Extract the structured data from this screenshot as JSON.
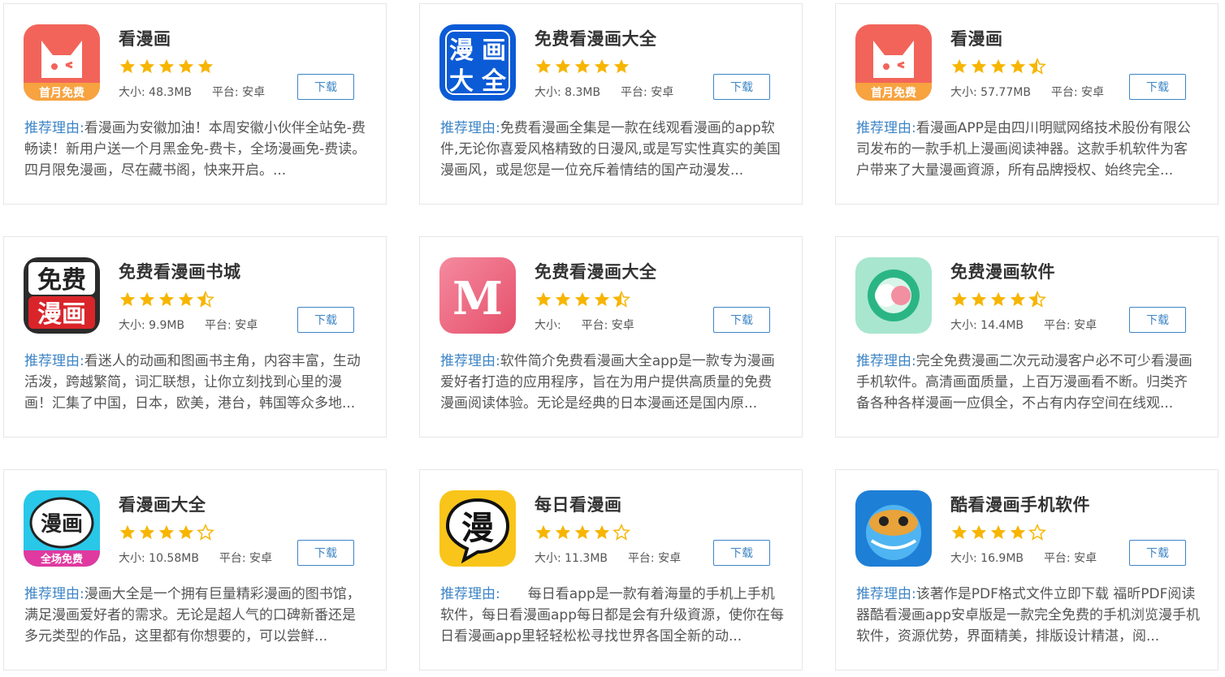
{
  "colors": {
    "accent": "#3d85c6",
    "star": "#f7b500",
    "star_empty": "#f7b500"
  },
  "download_label": "下载",
  "size_label": "大小:",
  "platform_label": "平台:",
  "reason_label": "推荐理由:",
  "apps": [
    {
      "title": "看漫画",
      "icon": "red-cat-free-month-icon",
      "rating": 5,
      "size": "48.3MB",
      "platform": "安卓",
      "reason": "看漫画为安徽加油！本周安徽小伙伴全站免-费畅读！新用户送一个月黑金免-费卡，全场漫画免-费读。四月限免漫画，尽在藏书阁，快来开启。..."
    },
    {
      "title": "免费看漫画大全",
      "icon": "blue-manhua-daquan-icon",
      "rating": 5,
      "size": "8.3MB",
      "platform": "安卓",
      "reason": "免费看漫画全集是一款在线观看漫画的app软件,无论你喜爱风格精致的日漫风,或是写实性真实的美国漫画风，或是您是一位充斥着情结的国产动漫发..."
    },
    {
      "title": "看漫画",
      "icon": "red-cat-free-month-icon",
      "rating": 4.5,
      "size": "57.77MB",
      "platform": "安卓",
      "reason": "看漫画APP是由四川明赋网络技术股份有限公司发布的一款手机上漫画阅读神器。这款手机软件为客户带来了大量漫画資源，所有品牌授权、始终完全..."
    },
    {
      "title": "免费看漫画书城",
      "icon": "free-manhua-black-red-icon",
      "rating": 4.5,
      "size": "9.9MB",
      "platform": "安卓",
      "reason": "看迷人的动画和图画书主角，内容丰富，生动活泼，跨越繁简，词汇联想，让你立刻找到心里的漫画！汇集了中国，日本，欧美，港台，韩国等众多地..."
    },
    {
      "title": "免费看漫画大全",
      "icon": "pink-m-icon",
      "rating": 4.5,
      "size": "",
      "platform": "安卓",
      "reason": "软件简介免费看漫画大全app是一款专为漫画爱好者打造的应用程序，旨在为用户提供高质量的免费漫画阅读体验。无论是经典的日本漫画还是国内原..."
    },
    {
      "title": "免费漫画软件",
      "icon": "mint-circle-icon",
      "rating": 4.5,
      "size": "14.4MB",
      "platform": "安卓",
      "reason": "完全免费漫画二次元动漫客户必不可少看漫画手机软件。高清画面质量，上百万漫画看不断。归类齐备各种各样漫画一应俱全，不占有内存空间在线观..."
    },
    {
      "title": "看漫画大全",
      "icon": "cyan-manhua-all-free-icon",
      "rating": 4,
      "size": "10.58MB",
      "platform": "安卓",
      "reason": "漫画大全是一个拥有巨量精彩漫画的图书馆，满足漫画爱好者的需求。无论是超人气的口碑新番还是多元类型的作品，这里都有你想要的，可以尝鲜..."
    },
    {
      "title": "每日看漫画",
      "icon": "yellow-man-bubble-icon",
      "rating": 4,
      "size": "11.3MB",
      "platform": "安卓",
      "reason": "　　每日看app是一款有着海量的手机上手机软件，每日看漫画app每日都是会有升级資源，使你在每日看漫画app里轻轻松松寻找世界各国全新的动..."
    },
    {
      "title": "酷看漫画手机软件",
      "icon": "blue-bear-pilot-icon",
      "rating": 4,
      "size": "16.9MB",
      "platform": "安卓",
      "reason": "该著作是PDF格式文件立即下载 福昕PDF阅读器酷看漫画app安卓版是一款完全免费的手机浏览漫手机软件，资源优势，界面精美，排版设计精湛，阅..."
    }
  ]
}
